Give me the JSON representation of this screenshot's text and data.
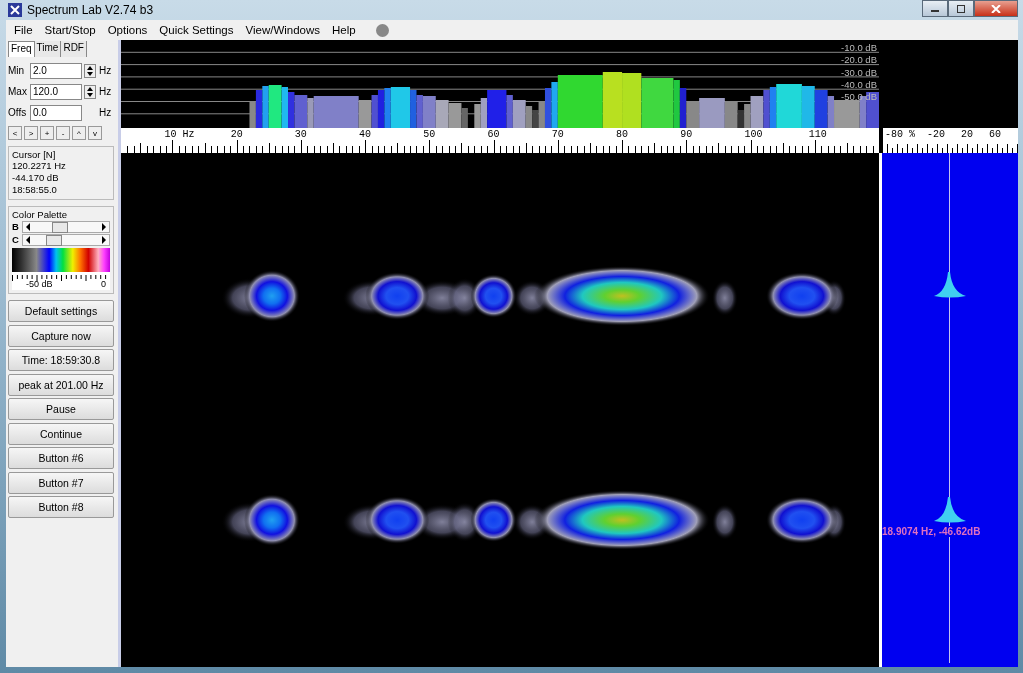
{
  "window": {
    "title": "Spectrum Lab V2.74 b3"
  },
  "menu": [
    {
      "label": "File"
    },
    {
      "label": "Start/Stop"
    },
    {
      "label": "Options"
    },
    {
      "label": "Quick Settings"
    },
    {
      "label": "View/Windows"
    },
    {
      "label": "Help"
    }
  ],
  "tabs": [
    {
      "label": "Freq",
      "selected": true
    },
    {
      "label": "Time",
      "selected": false
    },
    {
      "label": "RDF",
      "selected": false
    }
  ],
  "fields": [
    {
      "label": "Min",
      "value": "2.0",
      "unit": "Hz",
      "spinner": true
    },
    {
      "label": "Max",
      "value": "120.0",
      "unit": "Hz",
      "spinner": true
    },
    {
      "label": "Offs",
      "value": "0.0",
      "unit": "Hz",
      "spinner": false
    }
  ],
  "nav_buttons": [
    "<",
    ">",
    "+",
    "-",
    "^",
    "v"
  ],
  "cursor": {
    "title": "Cursor [N]",
    "lines": [
      "120.2271 Hz",
      "-44.170 dB",
      "18:58:55.0"
    ]
  },
  "color_palette": {
    "title": "Color Palette",
    "sliders": [
      {
        "label": "B",
        "level": 0.4
      },
      {
        "label": "C",
        "level": 0.3
      }
    ],
    "min_label": "-50 dB",
    "max_label": "0"
  },
  "buttons": [
    "Default settings",
    "Capture now",
    "Time:  18:59:30.8",
    "peak at 201.00 Hz",
    "Pause",
    "Continue",
    "Button #6",
    "Button #7",
    "Button #8"
  ],
  "spectrum": {
    "db_labels": [
      "-10.0 dB",
      "-20.0 dB",
      "-30.0 dB",
      "-40.0 dB",
      "-50.0 dB"
    ],
    "freq_labels": [
      "10 Hz",
      "20",
      "30",
      "40",
      "50",
      "60",
      "70",
      "80",
      "90",
      "100",
      "110"
    ]
  },
  "side_scale": {
    "labels": [
      "-80",
      "%",
      "-20",
      "20",
      "60"
    ]
  },
  "peak_label": "18.9074 Hz, -46.62dB"
}
